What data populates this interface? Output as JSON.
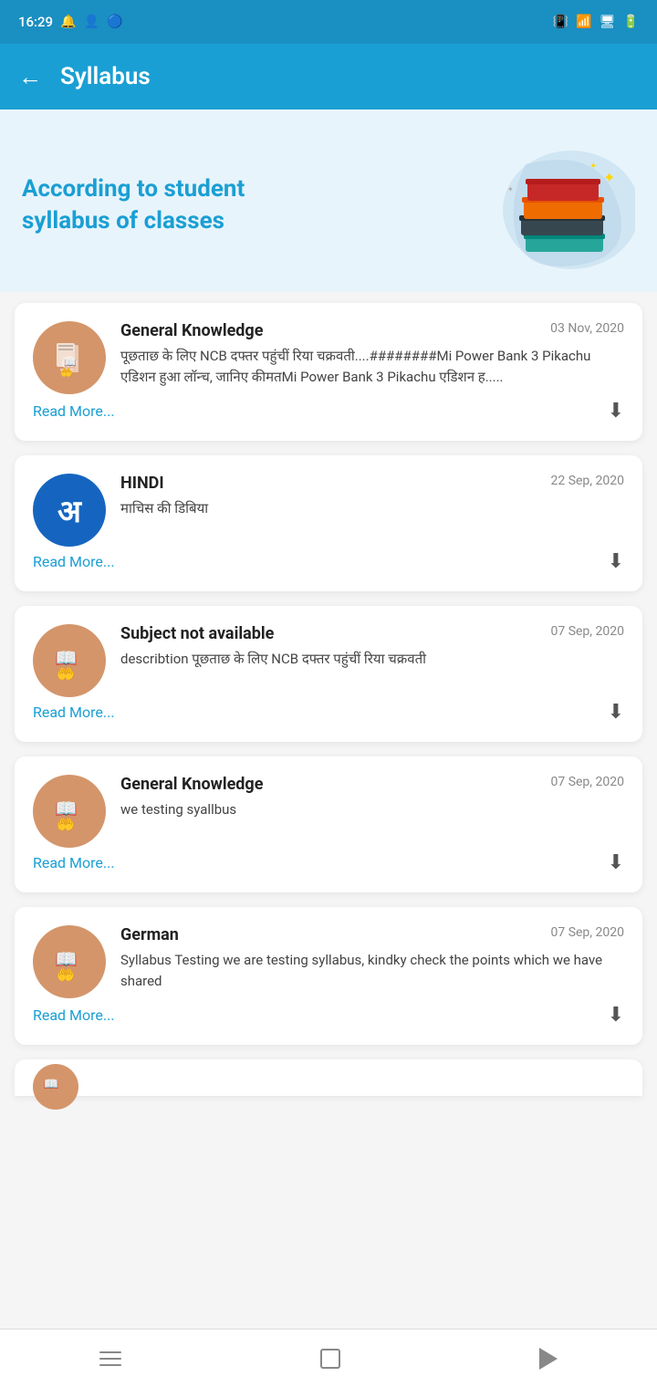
{
  "statusBar": {
    "time": "16:29",
    "icons": [
      "notification",
      "bluetooth"
    ]
  },
  "header": {
    "title": "Syllabus",
    "backLabel": "←"
  },
  "hero": {
    "line1": "According to student",
    "line2": "syllabus of classes"
  },
  "cards": [
    {
      "id": 1,
      "subject": "General Knowledge",
      "date": "03 Nov, 2020",
      "description": "पूछताछ के लिए NCB दफ्तर पहुंचीं रिया चक्रवती....########Mi Power Bank 3 Pikachu एडिशन हुआ लॉन्च, जानिए कीमतMi Power Bank 3 Pikachu एडिशन ह.....",
      "readMore": "Read More...",
      "iconType": "book",
      "hasDownload": true
    },
    {
      "id": 2,
      "subject": "HINDI",
      "date": "22 Sep, 2020",
      "description": "माचिस की डिबिया",
      "readMore": "Read More...",
      "iconType": "hindi",
      "hasDownload": true
    },
    {
      "id": 3,
      "subject": "Subject not available",
      "date": "07 Sep, 2020",
      "description": "describtion पूछताछ के लिए NCB दफ्तर पहुंचीं रिया चक्रवती",
      "readMore": "Read More...",
      "iconType": "book",
      "hasDownload": true
    },
    {
      "id": 4,
      "subject": "General Knowledge",
      "date": "07 Sep, 2020",
      "description": "we testing syallbus",
      "readMore": "Read More...",
      "iconType": "book",
      "hasDownload": true
    },
    {
      "id": 5,
      "subject": "German",
      "date": "07 Sep, 2020",
      "description": "Syllabus Testing we are testing syllabus, kindky check the points which we have shared",
      "readMore": "Read More...",
      "iconType": "book",
      "hasDownload": true
    }
  ],
  "nav": {
    "menu": "menu",
    "home": "home",
    "back": "back"
  }
}
